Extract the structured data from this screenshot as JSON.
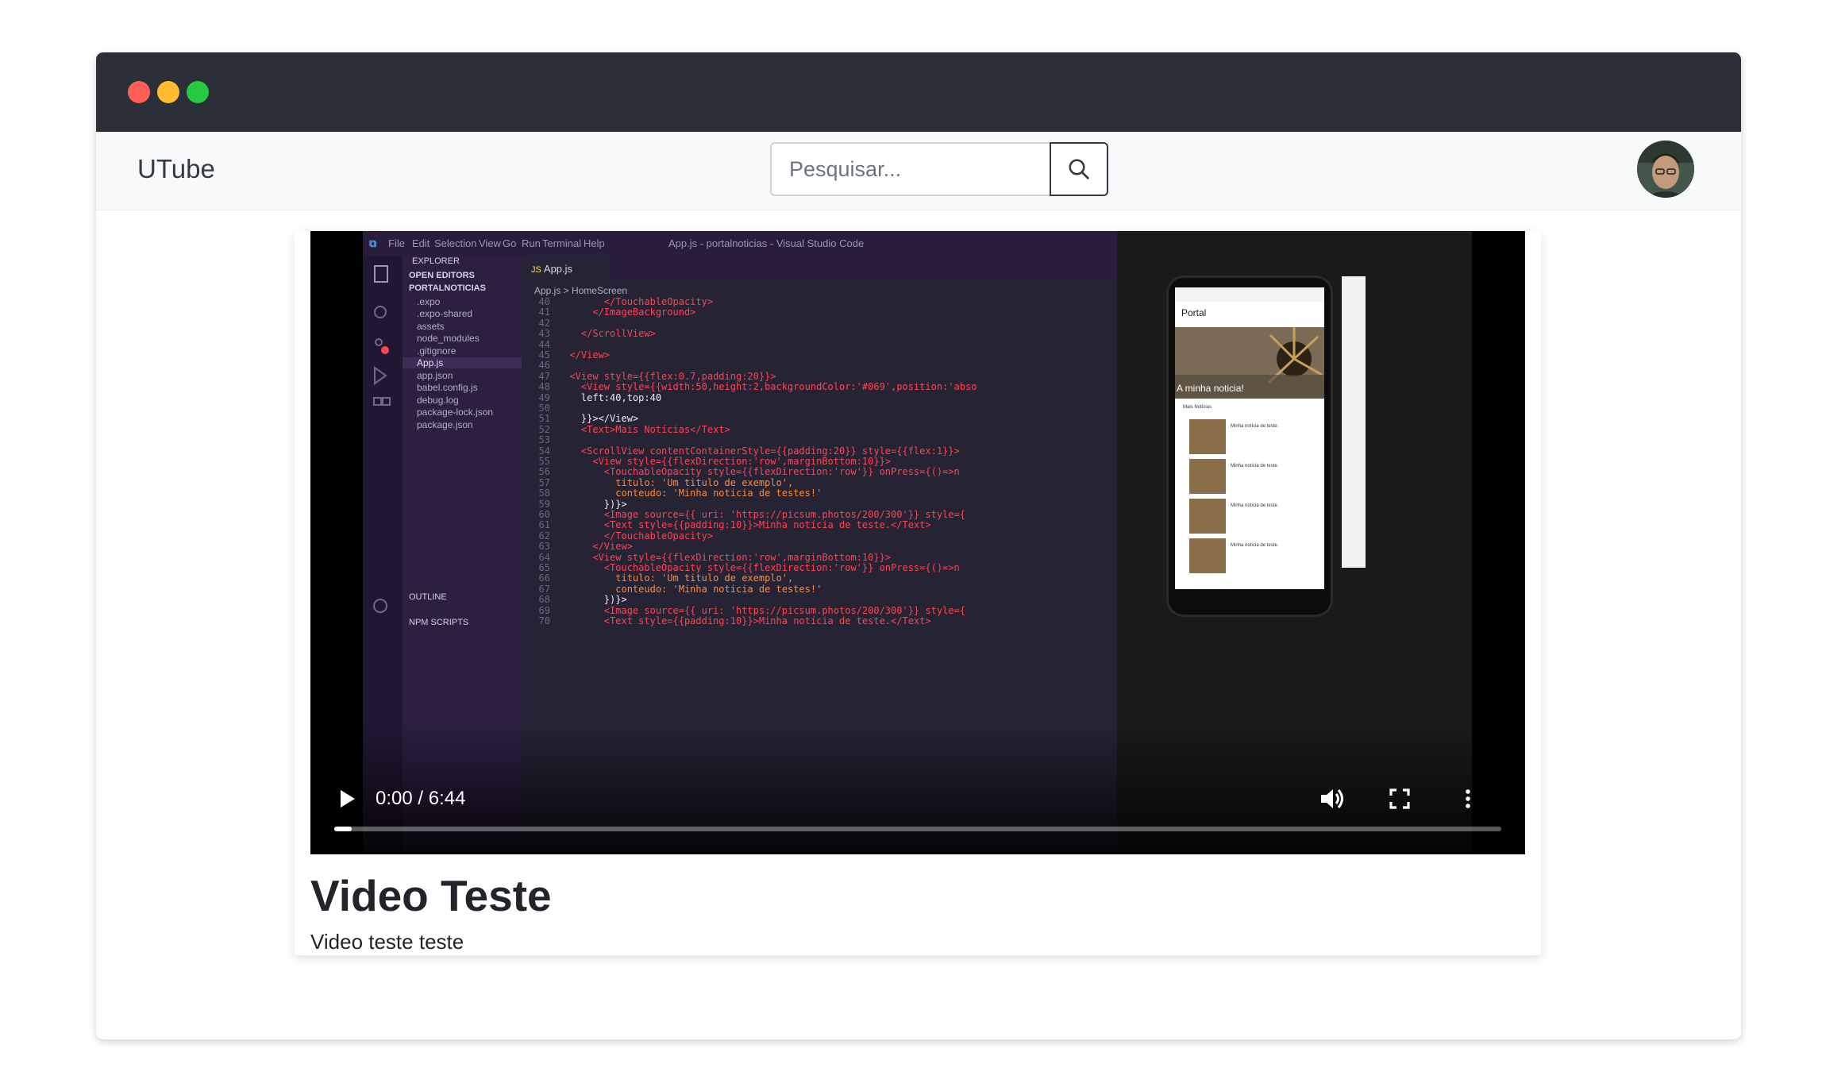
{
  "app": {
    "brand": "UTube"
  },
  "search": {
    "placeholder": "Pesquisar..."
  },
  "player": {
    "time_display": "0:00 / 6:44",
    "progress": 0.0,
    "frame": {
      "vscode_title": "App.js - portalnoticias - Visual Studio Code",
      "menu": [
        "File",
        "Edit",
        "Selection",
        "View",
        "Go",
        "Run",
        "Terminal",
        "Help"
      ],
      "sidebar_title": "EXPLORER",
      "open_editors": "OPEN EDITORS",
      "project": "PORTALNOTICIAS",
      "files": [
        ".expo",
        ".expo-shared",
        "assets",
        "node_modules",
        ".gitignore",
        "App.js",
        "app.json",
        "babel.config.js",
        "debug.log",
        "package-lock.json",
        "package.json"
      ],
      "outline": "OUTLINE",
      "npm_scripts": "NPM SCRIPTS",
      "tab": "App.js",
      "breadcrumb": "App.js > HomeScreen",
      "code_lines": [
        {
          "n": "40",
          "t": "        </TouchableOpacity>"
        },
        {
          "n": "41",
          "t": "      </ImageBackground>"
        },
        {
          "n": "42",
          "t": ""
        },
        {
          "n": "43",
          "t": "    </ScrollView>"
        },
        {
          "n": "44",
          "t": ""
        },
        {
          "n": "45",
          "t": "  </View>"
        },
        {
          "n": "46",
          "t": ""
        },
        {
          "n": "47",
          "t": "  <View style={{flex:0.7,padding:20}}>"
        },
        {
          "n": "48",
          "t": "    <View style={{width:50,height:2,backgroundColor:'#069',position:'abso"
        },
        {
          "n": "49",
          "t": "    left:40,top:40"
        },
        {
          "n": "50",
          "t": ""
        },
        {
          "n": "51",
          "t": "    }}></View>"
        },
        {
          "n": "52",
          "t": "    <Text>Mais Notícias</Text>"
        },
        {
          "n": "53",
          "t": ""
        },
        {
          "n": "54",
          "t": "    <ScrollView contentContainerStyle={{padding:20}} style={{flex:1}}>"
        },
        {
          "n": "55",
          "t": "      <View style={{flexDirection:'row',marginBottom:10}}>"
        },
        {
          "n": "56",
          "t": "        <TouchableOpacity style={{flexDirection:'row'}} onPress={()=>n"
        },
        {
          "n": "57",
          "t": "          titulo: 'Um titulo de exemplo',"
        },
        {
          "n": "58",
          "t": "          conteudo: 'Minha noticia de testes!'"
        },
        {
          "n": "59",
          "t": "        })}>"
        },
        {
          "n": "60",
          "t": "        <Image source={{ uri: 'https://picsum.photos/200/300'}} style={"
        },
        {
          "n": "61",
          "t": "        <Text style={{padding:10}}>Minha notícia de teste.</Text>"
        },
        {
          "n": "62",
          "t": "        </TouchableOpacity>"
        },
        {
          "n": "63",
          "t": "      </View>"
        },
        {
          "n": "64",
          "t": "      <View style={{flexDirection:'row',marginBottom:10}}>"
        },
        {
          "n": "65",
          "t": "        <TouchableOpacity style={{flexDirection:'row'}} onPress={()=>n"
        },
        {
          "n": "66",
          "t": "          titulo: 'Um titulo de exemplo',"
        },
        {
          "n": "67",
          "t": "          conteudo: 'Minha noticia de testes!'"
        },
        {
          "n": "68",
          "t": "        })}>"
        },
        {
          "n": "69",
          "t": "        <Image source={{ uri: 'https://picsum.photos/200/300'}} style={"
        },
        {
          "n": "70",
          "t": "        <Text style={{padding:10}}>Minha notícia de teste.</Text>"
        }
      ],
      "phone": {
        "header": "Portal",
        "hero_caption": "A minha noticia!",
        "section": "Mais Notícias",
        "items": [
          "Minha notícia de teste.",
          "Minha notícia de teste.",
          "Minha notícia de teste.",
          "Minha notícia de teste."
        ]
      }
    }
  },
  "video": {
    "title": "Video Teste",
    "description": "Video teste teste"
  },
  "colors": {
    "titlebar": "#2b3038",
    "navbar": "#f8f9fa",
    "dot_red": "#ff5f57",
    "dot_yellow": "#febc2e",
    "dot_green": "#28c840"
  }
}
